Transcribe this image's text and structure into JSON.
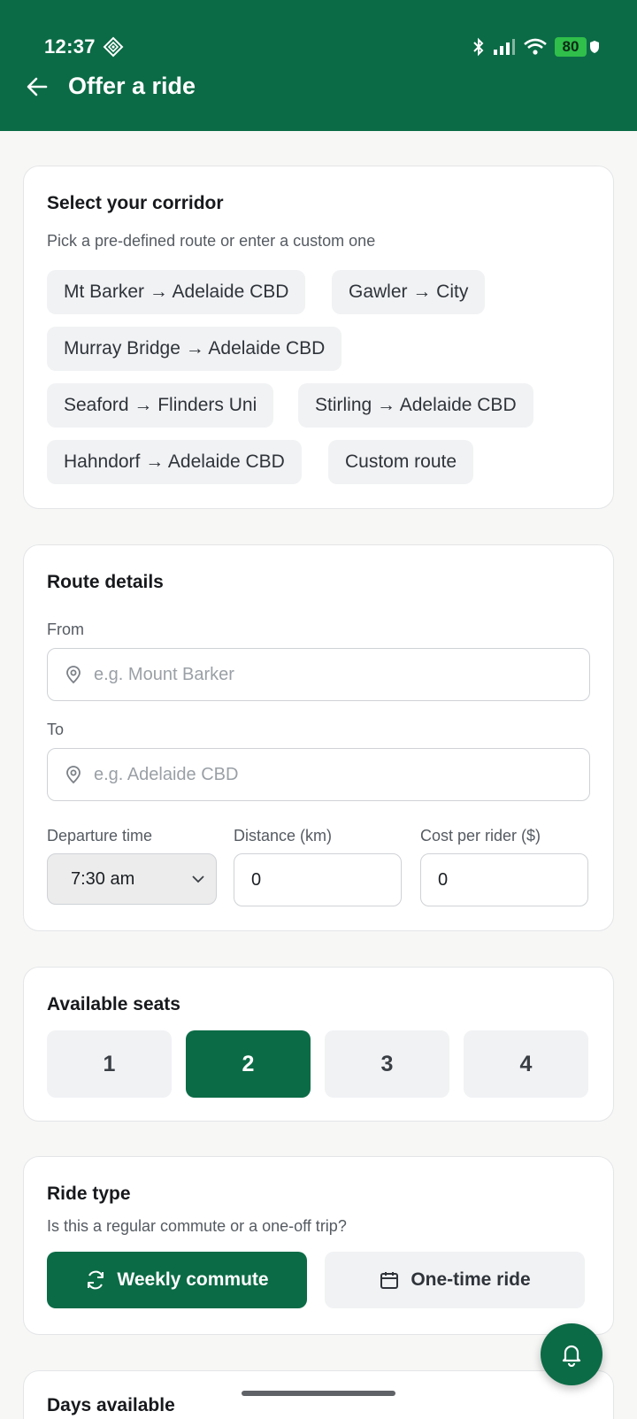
{
  "status_bar": {
    "time": "12:37",
    "battery": "80",
    "icons": [
      "diamond-icon",
      "bluetooth-icon",
      "signal-icon",
      "wifi-icon",
      "battery-icon"
    ]
  },
  "header": {
    "title": "Offer a ride",
    "back_icon": "arrow-left-icon",
    "color": "#0b6b46"
  },
  "corridor": {
    "title": "Select your corridor",
    "subtitle": "Pick a pre-defined route or enter a custom one",
    "routes": [
      "Mt Barker → Adelaide CBD",
      "Gawler → City",
      "Murray Bridge → Adelaide CBD",
      "Seaford → Flinders Uni",
      "Stirling → Adelaide CBD",
      "Hahndorf → Adelaide CBD",
      "Custom route"
    ]
  },
  "route_details": {
    "title": "Route details",
    "from_label": "From",
    "from_placeholder": "e.g. Mount Barker",
    "to_label": "To",
    "to_placeholder": "e.g. Adelaide CBD",
    "departure_label": "Departure time",
    "departure_value": "7:30 am",
    "distance_label": "Distance (km)",
    "distance_value": "0",
    "cost_label": "Cost per rider ($)",
    "cost_value": "0"
  },
  "seats": {
    "title": "Available seats",
    "options": [
      "1",
      "2",
      "3",
      "4"
    ],
    "selected": "2"
  },
  "ride_type": {
    "title": "Ride type",
    "subtitle": "Is this a regular commute or a one-off trip?",
    "weekly_label": "Weekly commute",
    "onetime_label": "One-time ride",
    "selected": "Weekly commute"
  },
  "days": {
    "title": "Days available"
  },
  "fab": {
    "icon": "bell-icon"
  }
}
